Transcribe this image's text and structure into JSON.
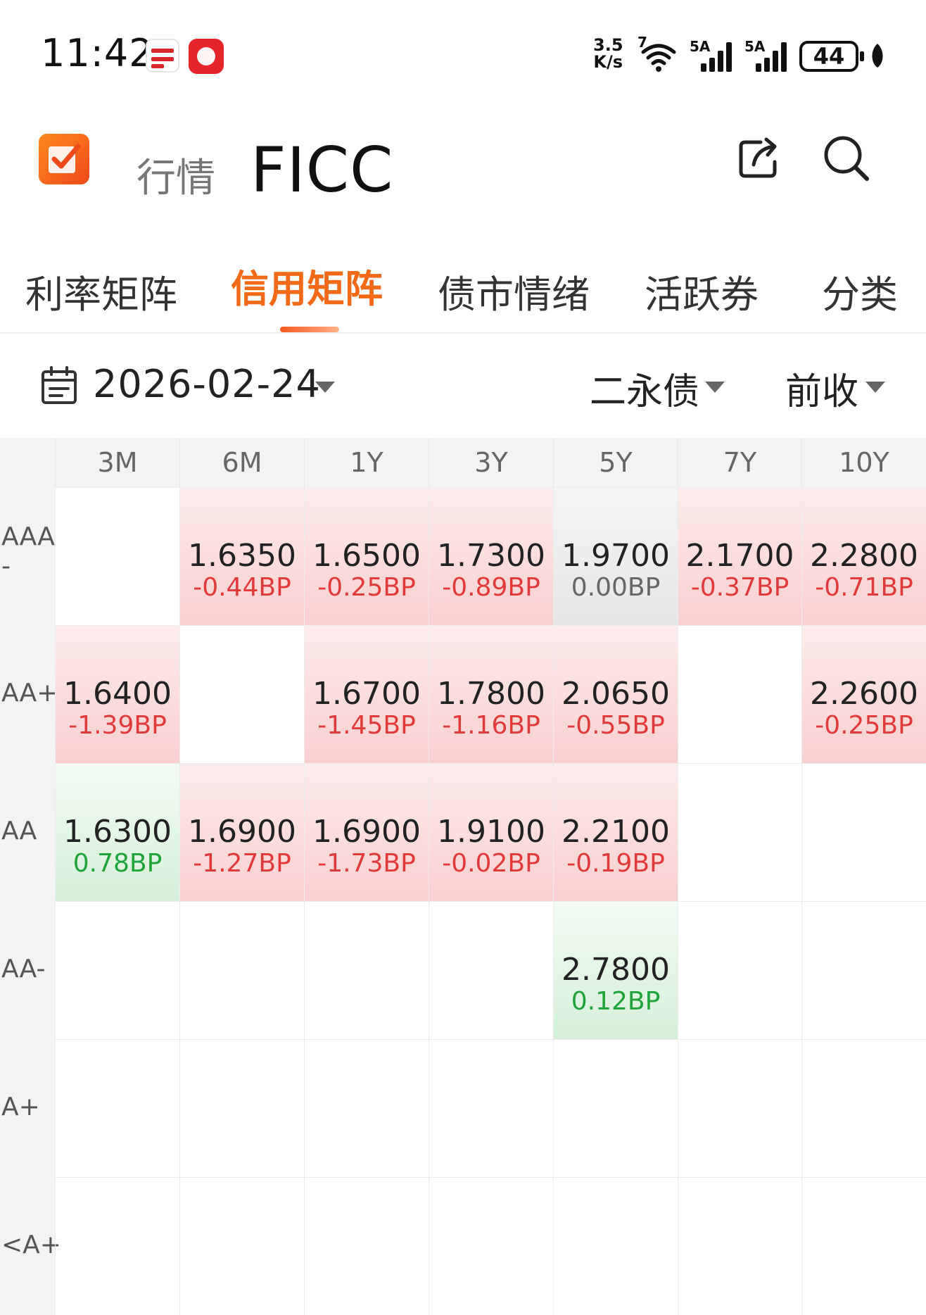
{
  "status_bar": {
    "time": "11:42",
    "net_speed_value": "3.5",
    "net_speed_unit": "K/s",
    "wifi_badge": "7",
    "sim1_label": "5A",
    "sim2_label": "5A",
    "battery": "44"
  },
  "header": {
    "section": "行情",
    "title": "FICC"
  },
  "tabs": [
    {
      "label": "利率矩阵",
      "active": false
    },
    {
      "label": "信用矩阵",
      "active": true
    },
    {
      "label": "债市情绪",
      "active": false
    },
    {
      "label": "活跃券",
      "active": false
    },
    {
      "label": "分类",
      "active": false
    }
  ],
  "filters": {
    "date": "2026-02-24",
    "bond_type": "二永债",
    "price_basis": "前收"
  },
  "matrix": {
    "columns": [
      "3M",
      "6M",
      "1Y",
      "3Y",
      "5Y",
      "7Y",
      "10Y"
    ],
    "rows": [
      {
        "label": "AAA\n-",
        "cells": [
          null,
          {
            "yield": "1.6350",
            "change": "-0.44BP",
            "dir": "up"
          },
          {
            "yield": "1.6500",
            "change": "-0.25BP",
            "dir": "up"
          },
          {
            "yield": "1.7300",
            "change": "-0.89BP",
            "dir": "up"
          },
          {
            "yield": "1.9700",
            "change": "0.00BP",
            "dir": "zero"
          },
          {
            "yield": "2.1700",
            "change": "-0.37BP",
            "dir": "up"
          },
          {
            "yield": "2.2800",
            "change": "-0.71BP",
            "dir": "up"
          }
        ]
      },
      {
        "label": "AA+",
        "cells": [
          {
            "yield": "1.6400",
            "change": "-1.39BP",
            "dir": "up"
          },
          null,
          {
            "yield": "1.6700",
            "change": "-1.45BP",
            "dir": "up"
          },
          {
            "yield": "1.7800",
            "change": "-1.16BP",
            "dir": "up"
          },
          {
            "yield": "2.0650",
            "change": "-0.55BP",
            "dir": "up"
          },
          null,
          {
            "yield": "2.2600",
            "change": "-0.25BP",
            "dir": "up"
          }
        ]
      },
      {
        "label": "AA",
        "cells": [
          {
            "yield": "1.6300",
            "change": "0.78BP",
            "dir": "down"
          },
          {
            "yield": "1.6900",
            "change": "-1.27BP",
            "dir": "up"
          },
          {
            "yield": "1.6900",
            "change": "-1.73BP",
            "dir": "up"
          },
          {
            "yield": "1.9100",
            "change": "-0.02BP",
            "dir": "up"
          },
          {
            "yield": "2.2100",
            "change": "-0.19BP",
            "dir": "up"
          },
          null,
          null
        ]
      },
      {
        "label": "AA-",
        "cells": [
          null,
          null,
          null,
          null,
          {
            "yield": "2.7800",
            "change": "0.12BP",
            "dir": "down"
          },
          null,
          null
        ]
      },
      {
        "label": "A+",
        "cells": [
          null,
          null,
          null,
          null,
          null,
          null,
          null
        ]
      },
      {
        "label": "<A+",
        "cells": [
          null,
          null,
          null,
          null,
          null,
          null,
          null
        ]
      }
    ]
  },
  "colors": {
    "accent": "#f26a17",
    "rise_red": "#e03a3a",
    "fall_green": "#1fa33a"
  }
}
